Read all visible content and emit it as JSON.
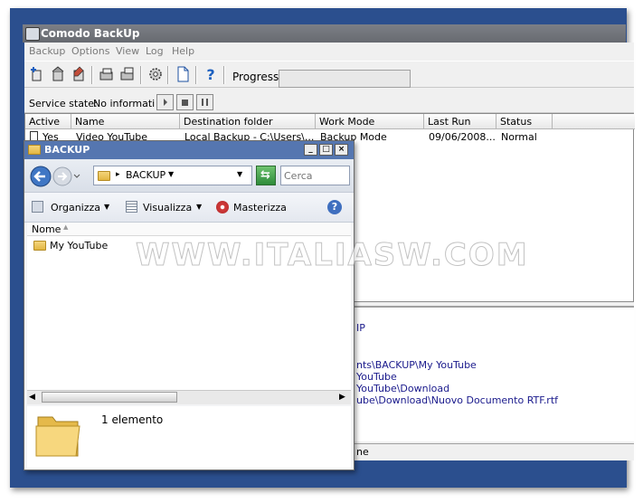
{
  "comodo": {
    "title": "Comodo BackUp",
    "menu": [
      "Backup",
      "Options",
      "View",
      "Log",
      "Help"
    ],
    "toolbar": {
      "icons": [
        "add-backup-icon",
        "restore-icon",
        "edit-backup-icon",
        "scan-icon",
        "scan-all-icon",
        "settings-icon",
        "document-icon",
        "help-icon"
      ],
      "progress_label": "Progress"
    },
    "service": {
      "label": "Service state:",
      "value": "No informatior"
    },
    "table": {
      "columns": [
        "Active",
        "Name",
        "Destination folder",
        "Work Mode",
        "Last Run",
        "Status"
      ],
      "rows": [
        {
          "active": "Yes",
          "name": "Video YouTube",
          "destination": "Local Backup - C:\\Users\\...",
          "work_mode": "Backup Mode",
          "last_run": "09/06/2008...",
          "status": "Normal"
        }
      ]
    },
    "log": [
      "IP",
      "nts\\BACKUP\\My YouTube",
      "YouTube",
      "YouTube\\Download",
      "ube\\Download\\Nuovo Documento RTF.rtf"
    ],
    "bottom_fragment": "ne"
  },
  "explorer": {
    "title": "BACKUP",
    "address": "BACKUP",
    "search_placeholder": "Cerca",
    "commands": {
      "organize": "Organizza",
      "view": "Visualizza",
      "burn": "Masterizza"
    },
    "column_header": "Nome",
    "items": [
      "My YouTube"
    ],
    "details": "1 elemento"
  },
  "watermark": "WWW.ITALIASW.COM",
  "colors": {
    "titlebar": "#676a70",
    "window_frame": "#2b4f8e",
    "explorer_title": "#5576b0",
    "log_text": "#1a1a8c"
  }
}
